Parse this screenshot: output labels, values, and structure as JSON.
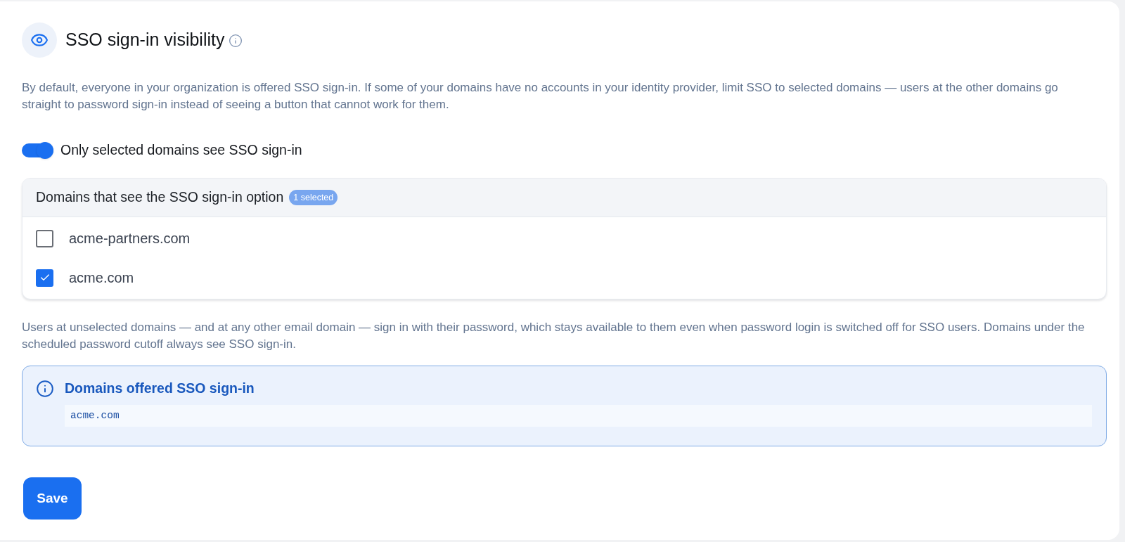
{
  "header": {
    "title": "SSO sign-in visibility"
  },
  "description": "By default, everyone in your organization is offered SSO sign-in. If some of your domains have no accounts in your identity provider, limit SSO to selected domains — users at the other domains go straight to password sign-in instead of seeing a button that cannot work for them.",
  "toggle": {
    "label": "Only selected domains see SSO sign-in",
    "on": true
  },
  "domains_panel": {
    "title": "Domains that see the SSO sign-in option",
    "badge": "1 selected",
    "domains": [
      {
        "name": "acme-partners.com",
        "checked": false
      },
      {
        "name": "acme.com",
        "checked": true
      }
    ]
  },
  "note": "Users at unselected domains — and at any other email domain — sign in with their password, which stays available to them even when password login is switched off for SSO users. Domains under the scheduled password cutoff always see SSO sign-in.",
  "offered_box": {
    "title": "Domains offered SSO sign-in",
    "code": "acme.com"
  },
  "buttons": [
    {
      "label": "Save"
    }
  ]
}
